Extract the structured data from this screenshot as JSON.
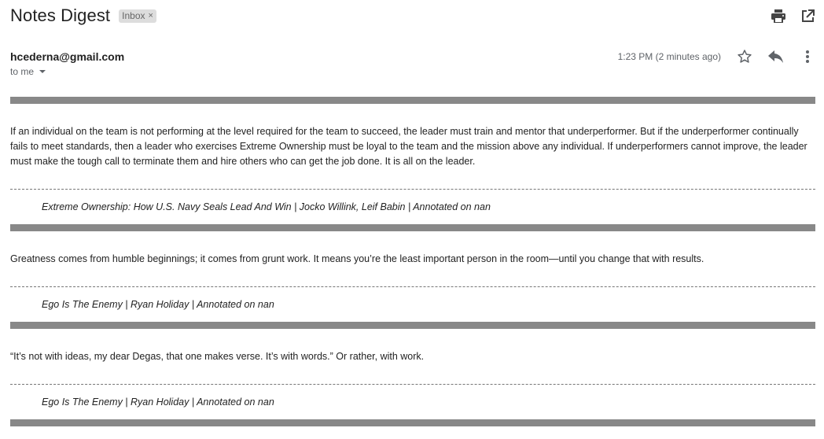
{
  "header": {
    "subject": "Notes Digest",
    "label_chip": "Inbox",
    "label_remove": "×",
    "icons": [
      "print-icon",
      "open-in-new-window-icon"
    ]
  },
  "message": {
    "sender": "hcederna@gmail.com",
    "recipient": "to me",
    "time": "1:23 PM (2 minutes ago)",
    "icons": [
      "star-icon",
      "reply-icon",
      "more-vert-icon"
    ]
  },
  "notes": [
    {
      "text": "If an individual on the team is not performing at the level required for the team to succeed, the leader must train and mentor that underperformer. But if the underperformer continually fails to meet standards, then a leader who exercises Extreme Ownership must be loyal to the team and the mission above any individual. If underperformers cannot improve, the leader must make the tough call to terminate them and hire others who can get the job done. It is all on the leader.",
      "source": "Extreme Ownership: How U.S. Navy Seals Lead And Win | Jocko Willink, Leif Babin | Annotated on nan"
    },
    {
      "text": "Greatness comes from humble beginnings; it comes from grunt work. It means you’re the least important person in the room—until you change that with results.",
      "source": "Ego Is The Enemy | Ryan Holiday | Annotated on nan"
    },
    {
      "text": "“It’s not with ideas, my dear Degas, that one makes verse. It’s with words.” Or rather, with work.",
      "source": "Ego Is The Enemy | Ryan Holiday | Annotated on nan"
    }
  ],
  "colors": {
    "divider_bar": "#888888",
    "label_chip_bg": "#dddddd",
    "meta_text": "#5f6368"
  }
}
